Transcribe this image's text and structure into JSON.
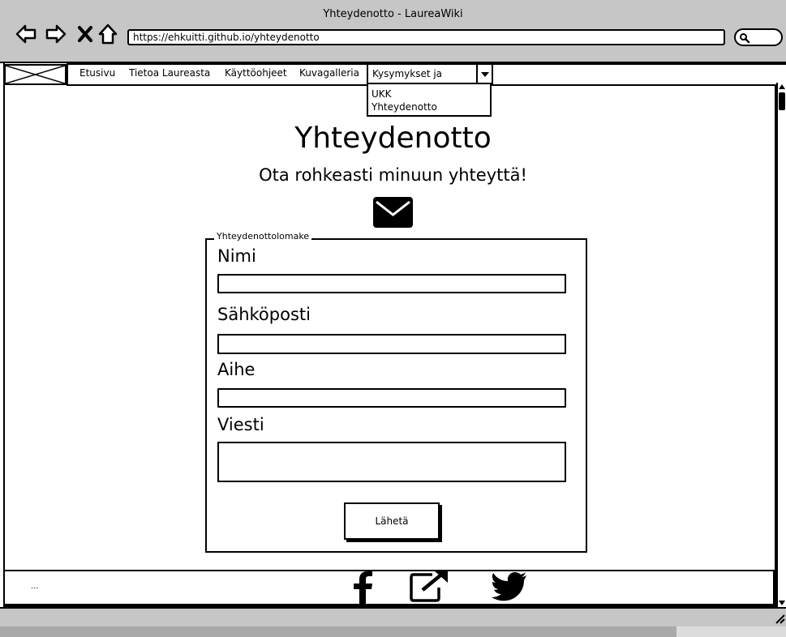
{
  "window": {
    "title": "Yhteydenotto - LaureaWiki"
  },
  "browser": {
    "url": "https://ehkuitti.github.io/yhteydenotto",
    "icons": [
      "back-arrow-icon",
      "forward-arrow-icon",
      "close-icon",
      "home-icon",
      "search-icon"
    ]
  },
  "nav": {
    "items": [
      "Etusivu",
      "Tietoa Laureasta",
      "Käyttöohjeet",
      "Kuvagalleria"
    ],
    "active": "Kysymykset ja kyselyt",
    "dropdown": [
      "UKK",
      "Yhteydenotto"
    ]
  },
  "main": {
    "title": "Yhteydenotto",
    "subtitle": "Ota rohkeasti minuun yhteyttä!",
    "icon": "envelope-icon"
  },
  "form": {
    "legend": "Yhteydenottolomake",
    "fields": [
      {
        "label": "Nimi",
        "value": ""
      },
      {
        "label": "Sähköposti",
        "value": ""
      },
      {
        "label": "Aihe",
        "value": ""
      },
      {
        "label": "Viesti",
        "value": ""
      }
    ],
    "submit": "Lähetä"
  },
  "footer": {
    "text": "...",
    "icons": [
      "facebook-icon",
      "external-link-icon",
      "twitter-icon"
    ]
  }
}
